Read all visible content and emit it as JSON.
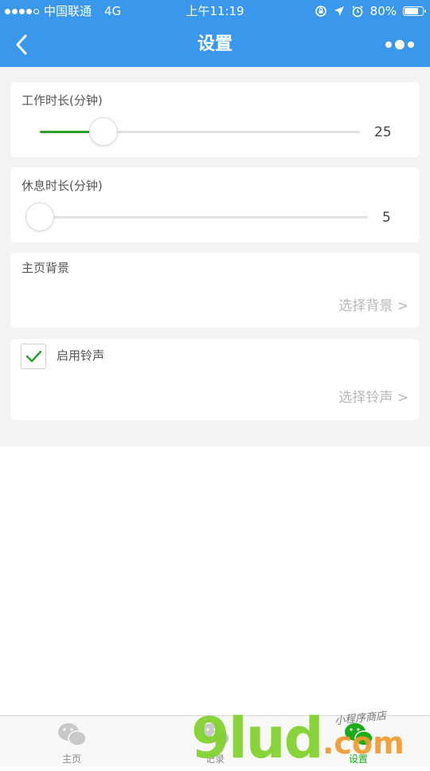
{
  "status_bar": {
    "carrier": "中国联通",
    "network": "4G",
    "time": "上午11:19",
    "battery": "80%",
    "battery_level": 0.8
  },
  "nav": {
    "title": "设置",
    "back_icon": "chevron-left-icon",
    "more_icon": "more-dots-icon",
    "color": "#3a98ec"
  },
  "settings": {
    "work_duration": {
      "label": "工作时长(分钟)",
      "value": "25",
      "slider_fraction": 0.2
    },
    "rest_duration": {
      "label": "休息时长(分钟)",
      "value": "5",
      "slider_fraction": 0.0
    },
    "background": {
      "label": "主页背景",
      "action": "选择背景 >"
    },
    "ringtone": {
      "label": "启用铃声",
      "checked": true,
      "action": "选择铃声 >"
    }
  },
  "tabbar": {
    "items": [
      {
        "label": "主页",
        "icon": "wechat-icon"
      },
      {
        "label": "记录",
        "icon": "wechat-icon"
      },
      {
        "label": "设置",
        "icon": "wechat-icon",
        "active": true
      }
    ]
  },
  "watermark": {
    "main": "9lud",
    "suffix": ".com",
    "handwriting": "小程序商店"
  },
  "colors": {
    "accent_green": "#2aa02a",
    "tab_active": "#1aad19"
  }
}
